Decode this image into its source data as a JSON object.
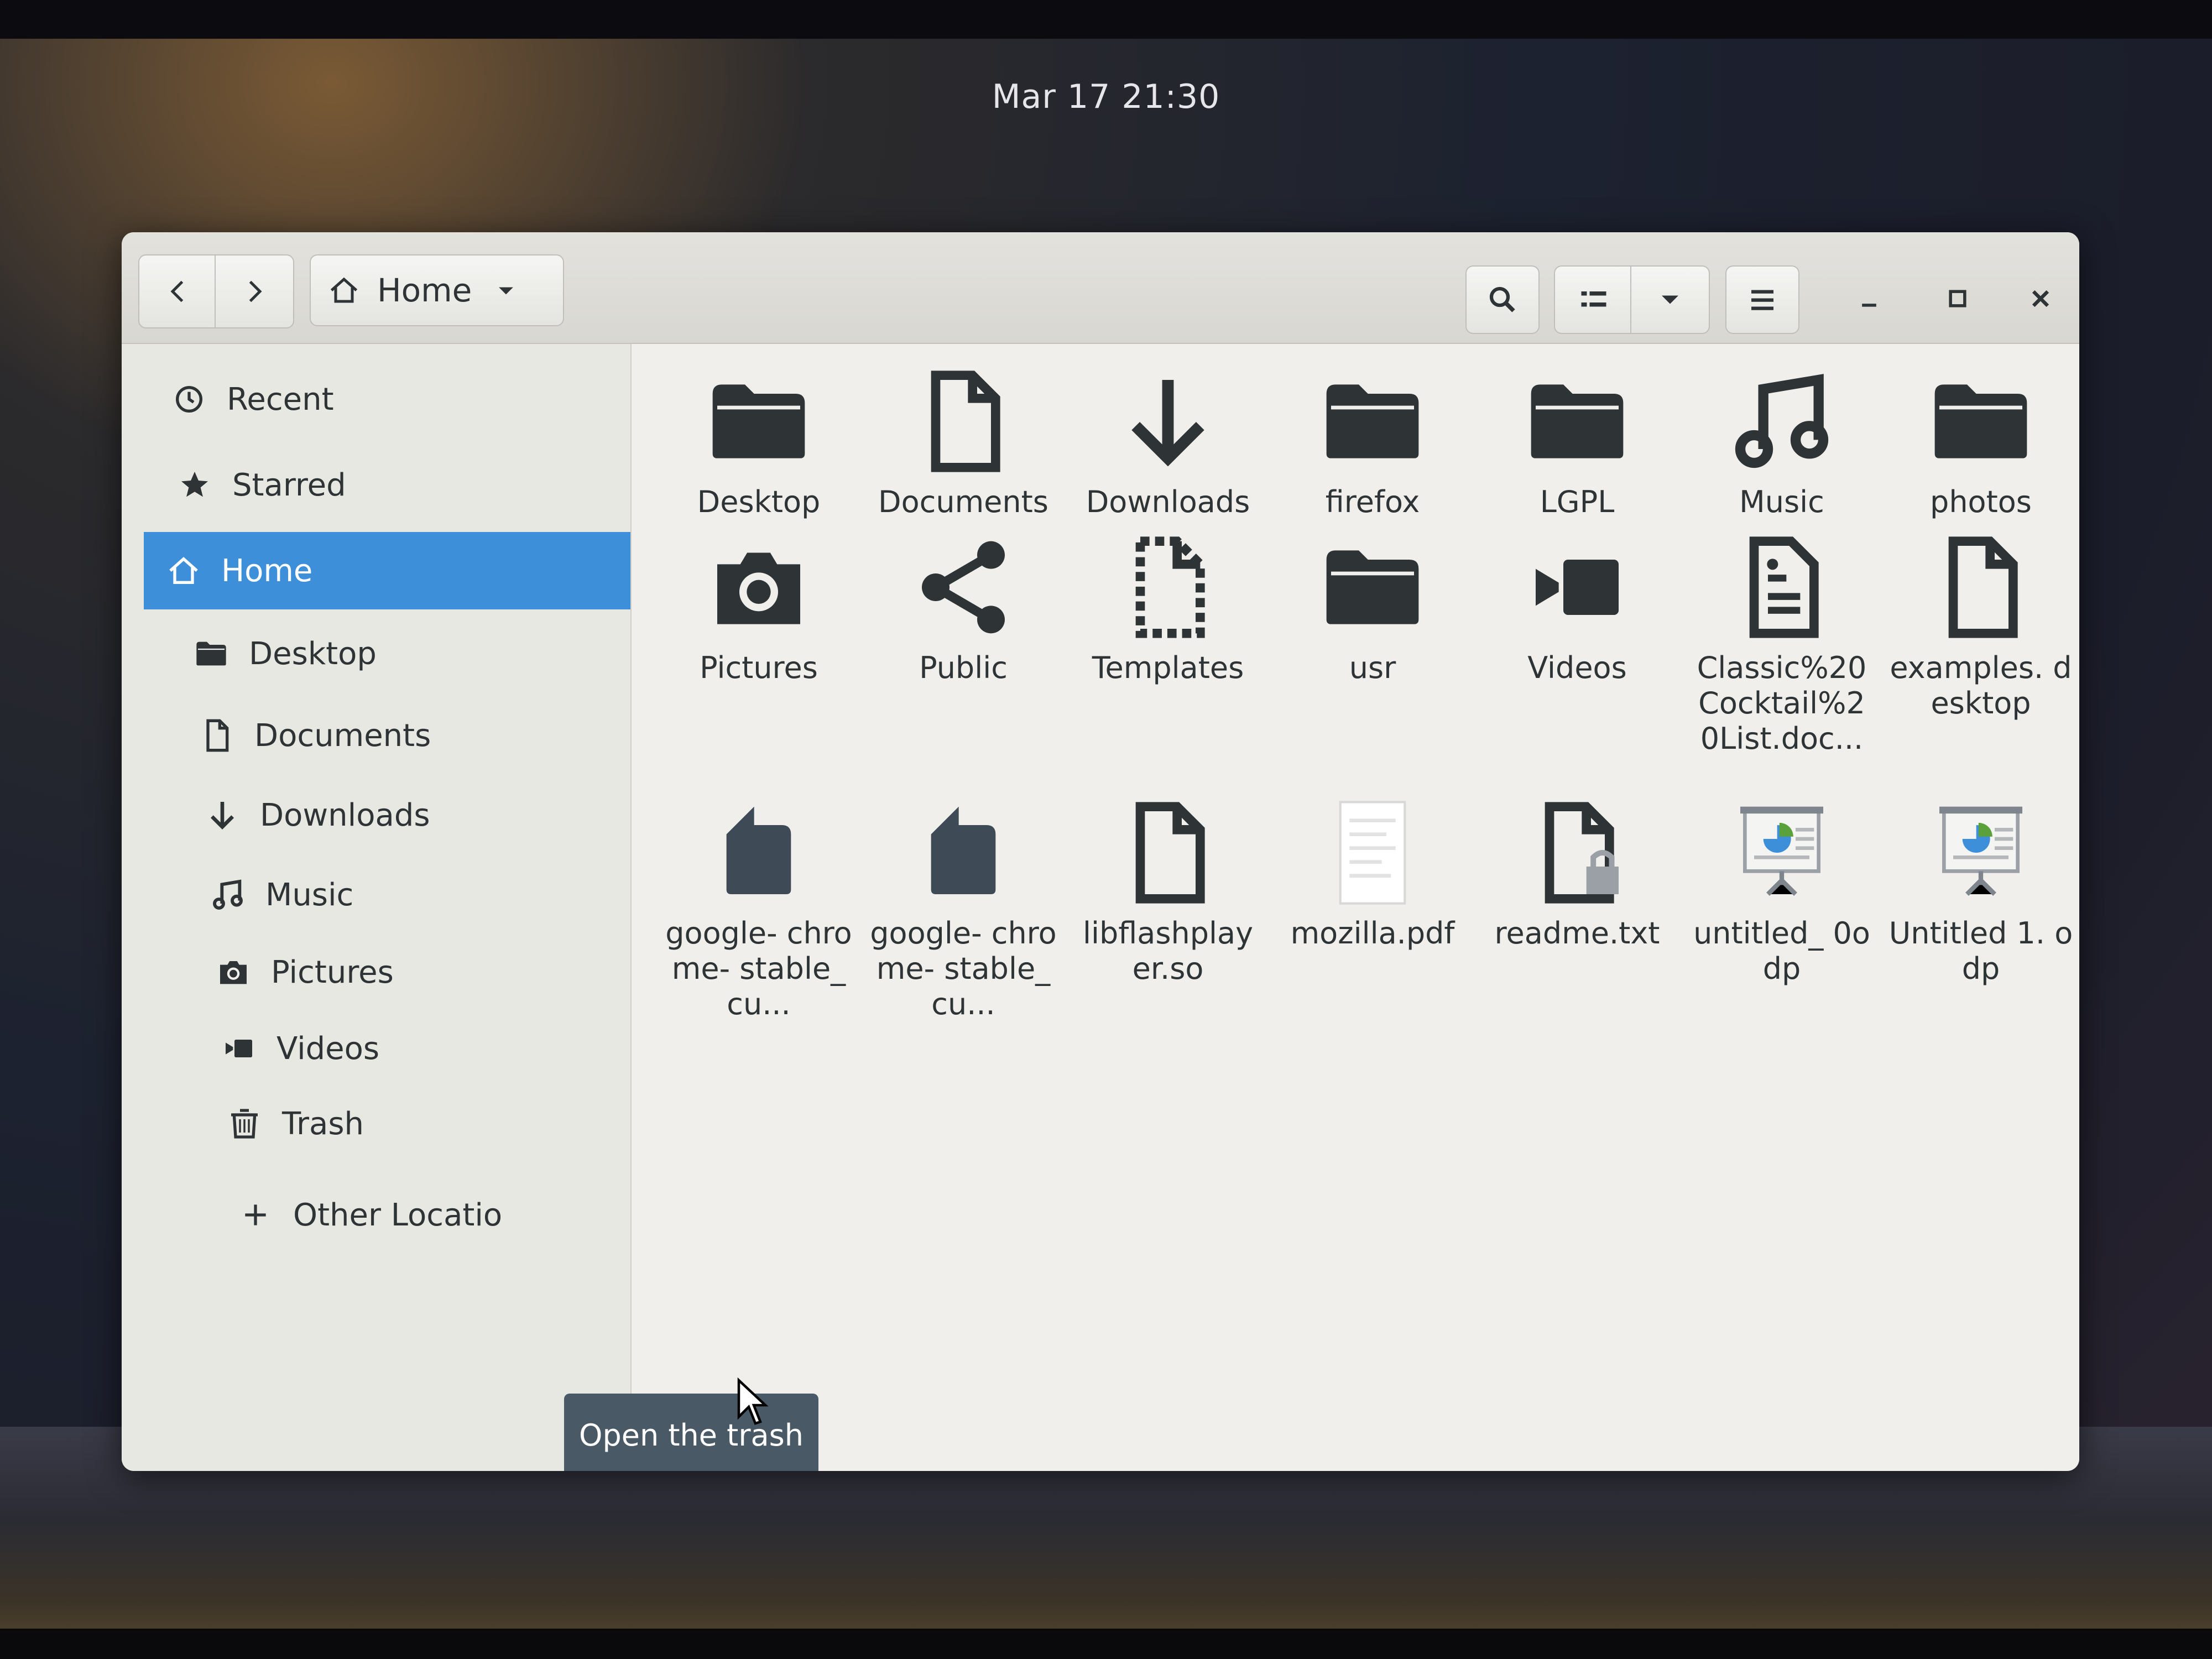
{
  "clock": "Mar 17  21:30",
  "window": {
    "path_label": "Home"
  },
  "sidebar": {
    "items": [
      {
        "label": "Recent",
        "icon": "clock-icon"
      },
      {
        "label": "Starred",
        "icon": "star-icon"
      },
      {
        "label": "Home",
        "icon": "home-icon",
        "active": true
      },
      {
        "label": "Desktop",
        "icon": "folder-icon"
      },
      {
        "label": "Documents",
        "icon": "document-icon"
      },
      {
        "label": "Downloads",
        "icon": "download-icon"
      },
      {
        "label": "Music",
        "icon": "music-icon"
      },
      {
        "label": "Pictures",
        "icon": "camera-icon"
      },
      {
        "label": "Videos",
        "icon": "video-icon"
      },
      {
        "label": "Trash",
        "icon": "trash-icon"
      },
      {
        "label": "Other Locatio",
        "icon": "plus-icon"
      }
    ]
  },
  "files": [
    {
      "name": "Desktop",
      "icon": "folder-icon"
    },
    {
      "name": "Documents",
      "icon": "document-icon"
    },
    {
      "name": "Downloads",
      "icon": "download-icon"
    },
    {
      "name": "firefox",
      "icon": "folder-icon"
    },
    {
      "name": "LGPL",
      "icon": "folder-icon"
    },
    {
      "name": "Music",
      "icon": "music-icon"
    },
    {
      "name": "photos",
      "icon": "folder-icon"
    },
    {
      "name": "Pictures",
      "icon": "camera-icon"
    },
    {
      "name": "Public",
      "icon": "share-icon"
    },
    {
      "name": "Templates",
      "icon": "template-icon"
    },
    {
      "name": "usr",
      "icon": "folder-icon"
    },
    {
      "name": "Videos",
      "icon": "video-icon"
    },
    {
      "name": "Classic%20 Cocktail%2 0List.doc...",
      "icon": "text-document-icon"
    },
    {
      "name": "examples. desktop",
      "icon": "document-icon"
    },
    {
      "name": "google- chrome- stable_cu...",
      "icon": "package-icon"
    },
    {
      "name": "google- chrome- stable_cu...",
      "icon": "package-icon"
    },
    {
      "name": "libflashplay er.so",
      "icon": "document-icon"
    },
    {
      "name": "mozilla.pdf",
      "icon": "pdf-thumbnail-icon"
    },
    {
      "name": "readme.txt",
      "icon": "locked-document-icon"
    },
    {
      "name": "untitled_ 0odp",
      "icon": "presentation-icon"
    },
    {
      "name": "Untitled 1. odp",
      "icon": "presentation-icon"
    }
  ],
  "tooltip": "Open the trash",
  "colors": {
    "accent": "#3d8fd9",
    "tooltip_bg": "#4a5966"
  }
}
